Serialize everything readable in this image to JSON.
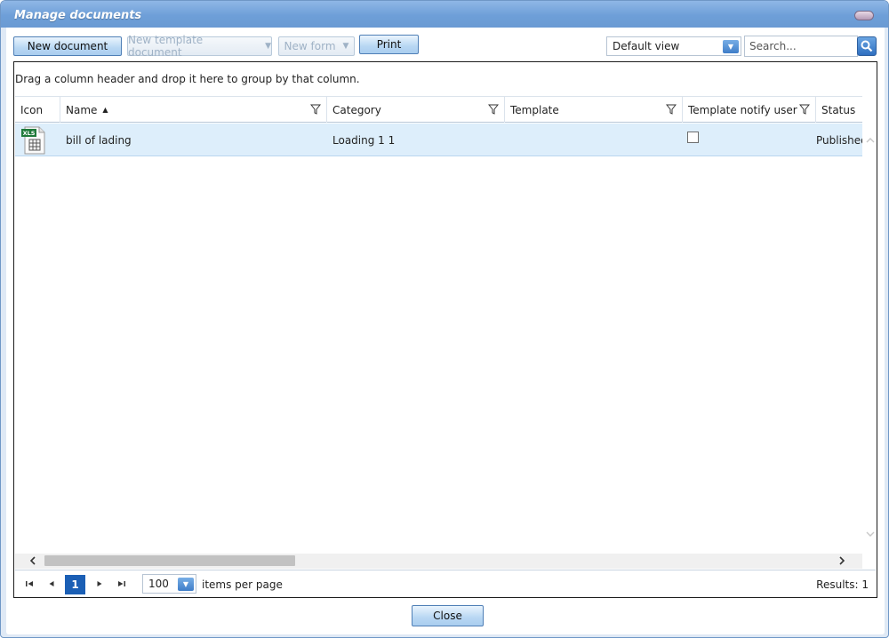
{
  "window": {
    "title": "Manage documents"
  },
  "toolbar": {
    "new_document": "New document",
    "new_template_document": "New template document",
    "new_form": "New form",
    "print": "Print",
    "view_select": "Default view",
    "search_placeholder": "Search..."
  },
  "grid": {
    "group_hint": "Drag a column header and drop it here to group by that column.",
    "columns": [
      "Icon",
      "Name",
      "Category",
      "Template",
      "Template notify user",
      "Status"
    ],
    "rows": [
      {
        "icon": "excel-file-icon",
        "icon_text": "XLS",
        "name": "bill of lading",
        "category": "Loading 1 1",
        "template": "",
        "template_notify_user": false,
        "status": "Published"
      }
    ]
  },
  "pager": {
    "current_page": "1",
    "page_size": "100",
    "items_per_page": "items per page",
    "results": "Results: 1"
  },
  "footer": {
    "close": "Close"
  },
  "colors": {
    "accent": "#1b5fb5",
    "title_bar": "#6e9fd8",
    "selected_row": "#ddeefb"
  }
}
